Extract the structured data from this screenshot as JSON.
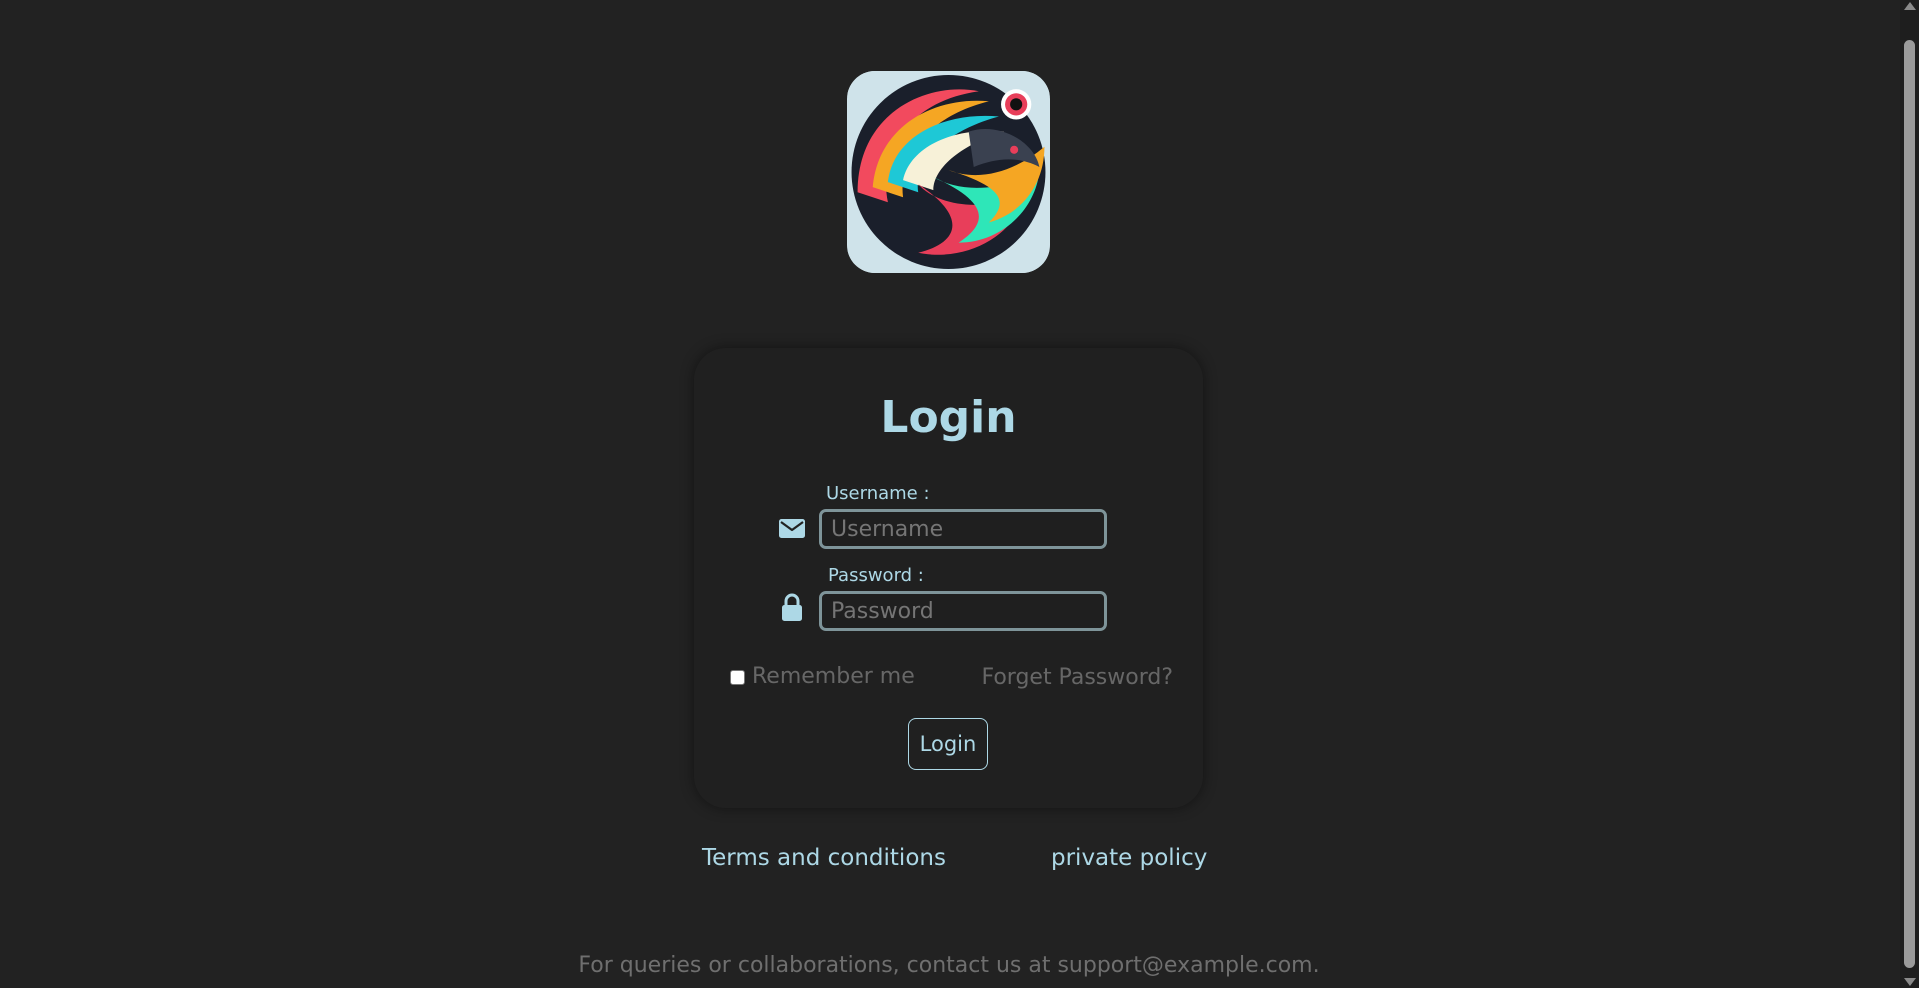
{
  "login": {
    "title": "Login",
    "username_label": "Username :",
    "username_placeholder": "Username",
    "username_value": "",
    "password_label": "Password :",
    "password_placeholder": "Password",
    "password_value": "",
    "remember_label": "Remember me",
    "remember_checked": false,
    "forgot_label": "Forget Password?",
    "submit_label": "Login"
  },
  "footer": {
    "terms_label": "Terms and conditions",
    "privacy_label": "private policy",
    "contact_text": "For queries or collaborations, contact us at support@example.com."
  },
  "icons": {
    "username": "envelope-icon",
    "password": "lock-icon"
  },
  "colors": {
    "background": "#222222",
    "card": "#202020",
    "accent": "#add8e6",
    "muted": "#676767"
  }
}
